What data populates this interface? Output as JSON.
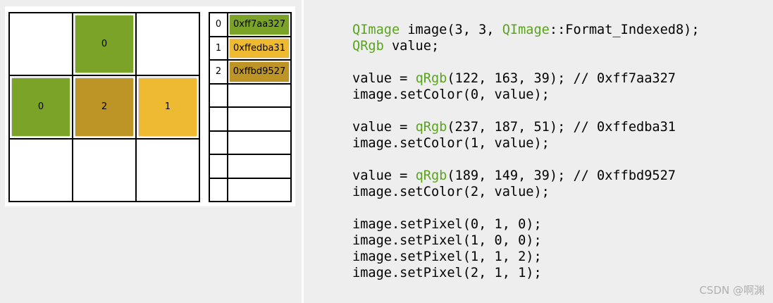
{
  "colors": {
    "green": "#7aa327",
    "yellow": "#edba31",
    "ochre": "#bd9527",
    "code_keyword": "#5aa31e"
  },
  "pixel_grid": [
    [
      "",
      "0",
      ""
    ],
    [
      "0",
      "2",
      "1"
    ],
    [
      "",
      "",
      ""
    ]
  ],
  "palette": [
    {
      "index": "0",
      "label": "0xff7aa327",
      "color": "#7aa327"
    },
    {
      "index": "1",
      "label": "0xffedba31",
      "color": "#edba31"
    },
    {
      "index": "2",
      "label": "0xffbd9527",
      "color": "#bd9527"
    },
    {
      "index": "",
      "label": "",
      "color": ""
    },
    {
      "index": "",
      "label": "",
      "color": ""
    },
    {
      "index": "",
      "label": "",
      "color": ""
    },
    {
      "index": "",
      "label": "",
      "color": ""
    },
    {
      "index": "",
      "label": "",
      "color": ""
    }
  ],
  "code_lines": [
    [
      {
        "t": "QImage",
        "k": true
      },
      {
        "t": " image(3, 3, ",
        "k": false
      },
      {
        "t": "QImage",
        "k": true
      },
      {
        "t": "::Format_Indexed8);",
        "k": false
      }
    ],
    [
      {
        "t": "QRgb",
        "k": true
      },
      {
        "t": " value;",
        "k": false
      }
    ],
    [],
    [
      {
        "t": "value = ",
        "k": false
      },
      {
        "t": "qRgb",
        "k": true
      },
      {
        "t": "(122, 163, 39); // 0xff7aa327",
        "k": false
      }
    ],
    [
      {
        "t": "image.setColor(0, value);",
        "k": false
      }
    ],
    [],
    [
      {
        "t": "value = ",
        "k": false
      },
      {
        "t": "qRgb",
        "k": true
      },
      {
        "t": "(237, 187, 51); // 0xffedba31",
        "k": false
      }
    ],
    [
      {
        "t": "image.setColor(1, value);",
        "k": false
      }
    ],
    [],
    [
      {
        "t": "value = ",
        "k": false
      },
      {
        "t": "qRgb",
        "k": true
      },
      {
        "t": "(189, 149, 39); // 0xffbd9527",
        "k": false
      }
    ],
    [
      {
        "t": "image.setColor(2, value);",
        "k": false
      }
    ],
    [],
    [
      {
        "t": "image.setPixel(0, 1, 0);",
        "k": false
      }
    ],
    [
      {
        "t": "image.setPixel(1, 0, 0);",
        "k": false
      }
    ],
    [
      {
        "t": "image.setPixel(1, 1, 2);",
        "k": false
      }
    ],
    [
      {
        "t": "image.setPixel(2, 1, 1);",
        "k": false
      }
    ]
  ],
  "watermark": "CSDN @啊渊"
}
